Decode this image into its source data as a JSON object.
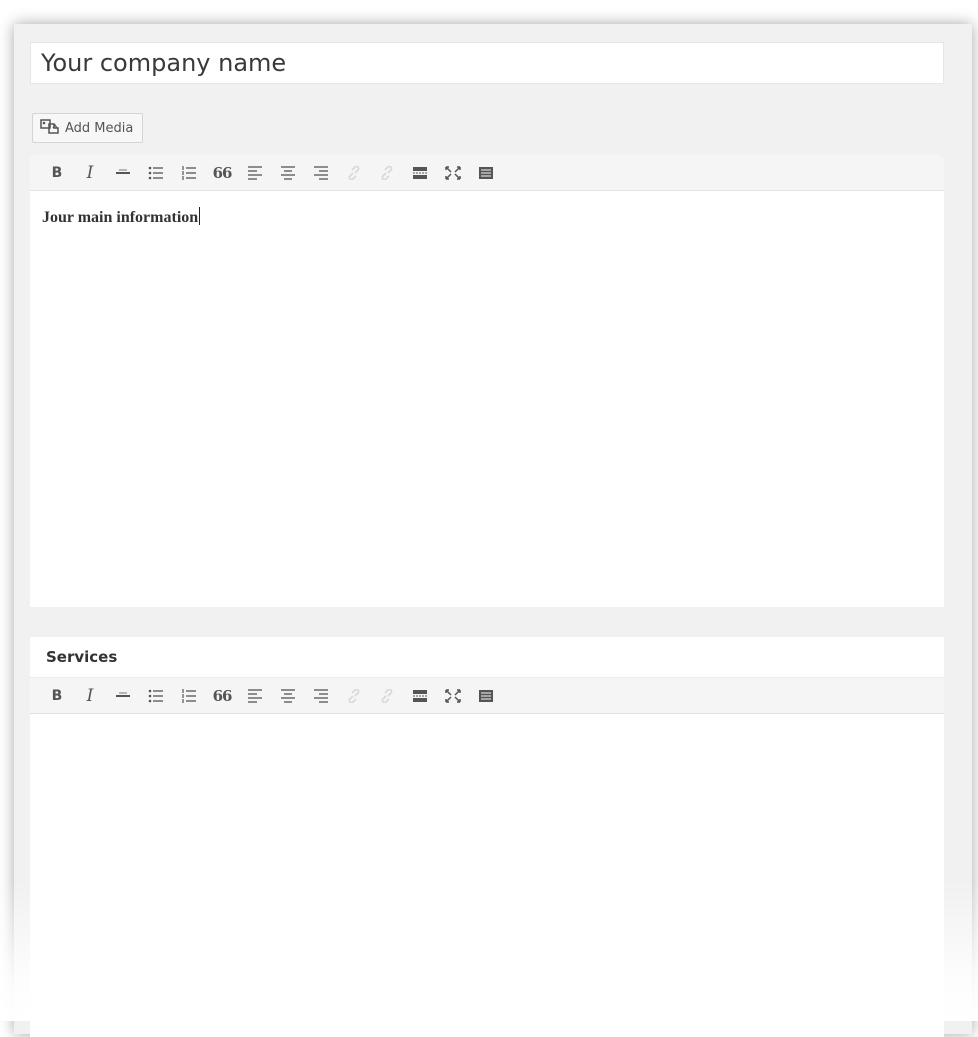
{
  "title_field": {
    "value": "Your company name"
  },
  "add_media": {
    "label": "Add Media",
    "icon": "media-icon"
  },
  "toolbar_buttons": [
    {
      "name": "bold",
      "glyph": "B"
    },
    {
      "name": "italic",
      "glyph": "I"
    },
    {
      "name": "strikethrough",
      "glyph": "—"
    },
    {
      "name": "bullet-list",
      "glyph": ""
    },
    {
      "name": "numbered-list",
      "glyph": ""
    },
    {
      "name": "blockquote",
      "glyph": "66"
    },
    {
      "name": "align-left",
      "glyph": ""
    },
    {
      "name": "align-center",
      "glyph": ""
    },
    {
      "name": "align-right",
      "glyph": ""
    },
    {
      "name": "link",
      "glyph": ""
    },
    {
      "name": "unlink",
      "glyph": ""
    },
    {
      "name": "read-more",
      "glyph": ""
    },
    {
      "name": "fullscreen",
      "glyph": ""
    },
    {
      "name": "toolbar-toggle",
      "glyph": ""
    }
  ],
  "main_editor": {
    "content": "Jour main information"
  },
  "services_editor": {
    "label": "Services",
    "content": ""
  },
  "colors": {
    "frame_bg": "#f1f1f1",
    "toolbar_bg": "#f5f5f5",
    "icon": "#555555",
    "disabled_icon": "#d8d8d8"
  }
}
